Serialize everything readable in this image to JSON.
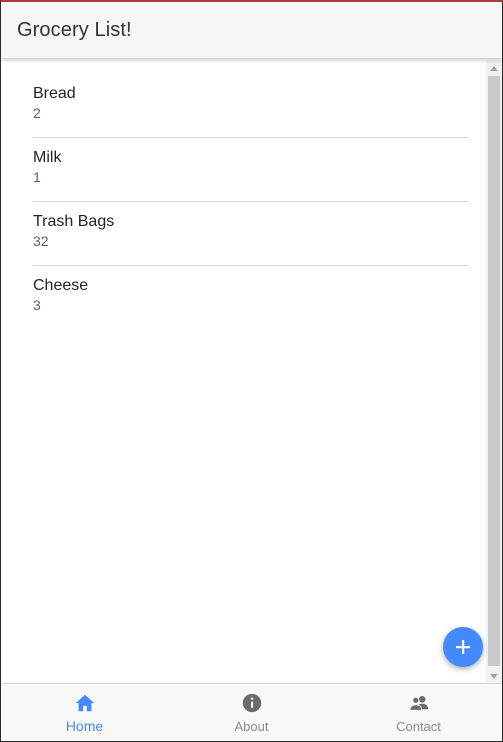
{
  "header": {
    "title": "Grocery List!"
  },
  "items": [
    {
      "name": "Bread",
      "quantity": "2"
    },
    {
      "name": "Milk",
      "quantity": "1"
    },
    {
      "name": "Trash Bags",
      "quantity": "32"
    },
    {
      "name": "Cheese",
      "quantity": "3"
    }
  ],
  "fab": {
    "icon": "plus-icon"
  },
  "tabs": [
    {
      "label": "Home",
      "icon": "home-icon",
      "active": true
    },
    {
      "label": "About",
      "icon": "info-icon",
      "active": false
    },
    {
      "label": "Contact",
      "icon": "contacts-icon",
      "active": false
    }
  ],
  "colors": {
    "accent": "#448aff",
    "header_bg": "#f6f6f6",
    "inactive_tab": "#8a8a8a",
    "divider": "#d9d9d9"
  }
}
